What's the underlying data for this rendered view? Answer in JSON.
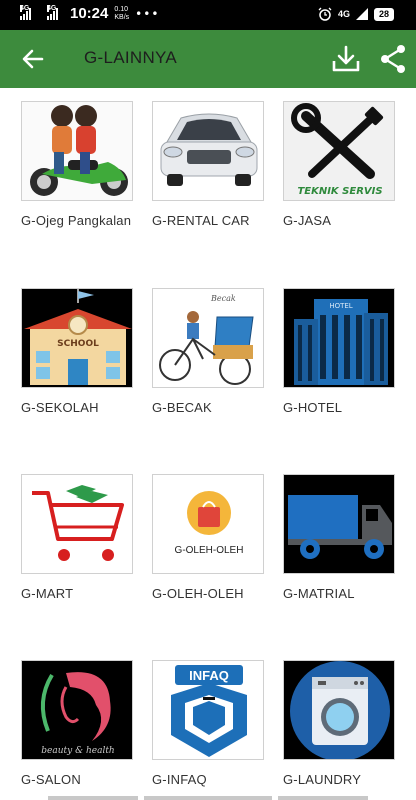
{
  "status_bar": {
    "net1": "4G",
    "net2": "4G",
    "time": "10:24",
    "speed_value": "0.10",
    "speed_unit": "KB/s",
    "dots": "•••",
    "net3": "4G",
    "battery": "28"
  },
  "app_bar": {
    "title": "G-LAINNYA",
    "back_icon": "arrow-back-icon",
    "download_icon": "download-icon",
    "share_icon": "share-icon",
    "color": "#3d8b3d"
  },
  "tiles": [
    {
      "label": "G-Ojeg Pangkalan",
      "icon": "motorcycle-icon"
    },
    {
      "label": "G-RENTAL CAR",
      "icon": "car-icon"
    },
    {
      "label": "G-JASA",
      "icon": "tools-icon",
      "caption": "TEKNIK SERVIS"
    },
    {
      "label": "G-SEKOLAH",
      "icon": "school-icon",
      "caption": "SCHOOL"
    },
    {
      "label": "G-BECAK",
      "icon": "pedicab-icon",
      "caption": "Becak"
    },
    {
      "label": "G-HOTEL",
      "icon": "hotel-icon",
      "caption": "HOTEL"
    },
    {
      "label": "G-MART",
      "icon": "cart-icon"
    },
    {
      "label": "G-OLEH-OLEH",
      "icon": "gift-bag-icon",
      "caption": "G-OLEH-OLEH"
    },
    {
      "label": "G-MATRIAL",
      "icon": "truck-icon"
    },
    {
      "label": "G-SALON",
      "icon": "salon-icon",
      "caption": "beauty & health"
    },
    {
      "label": "G-INFAQ",
      "icon": "infaq-box-icon",
      "caption": "INFAQ"
    },
    {
      "label": "G-LAUNDRY",
      "icon": "washing-machine-icon"
    }
  ]
}
